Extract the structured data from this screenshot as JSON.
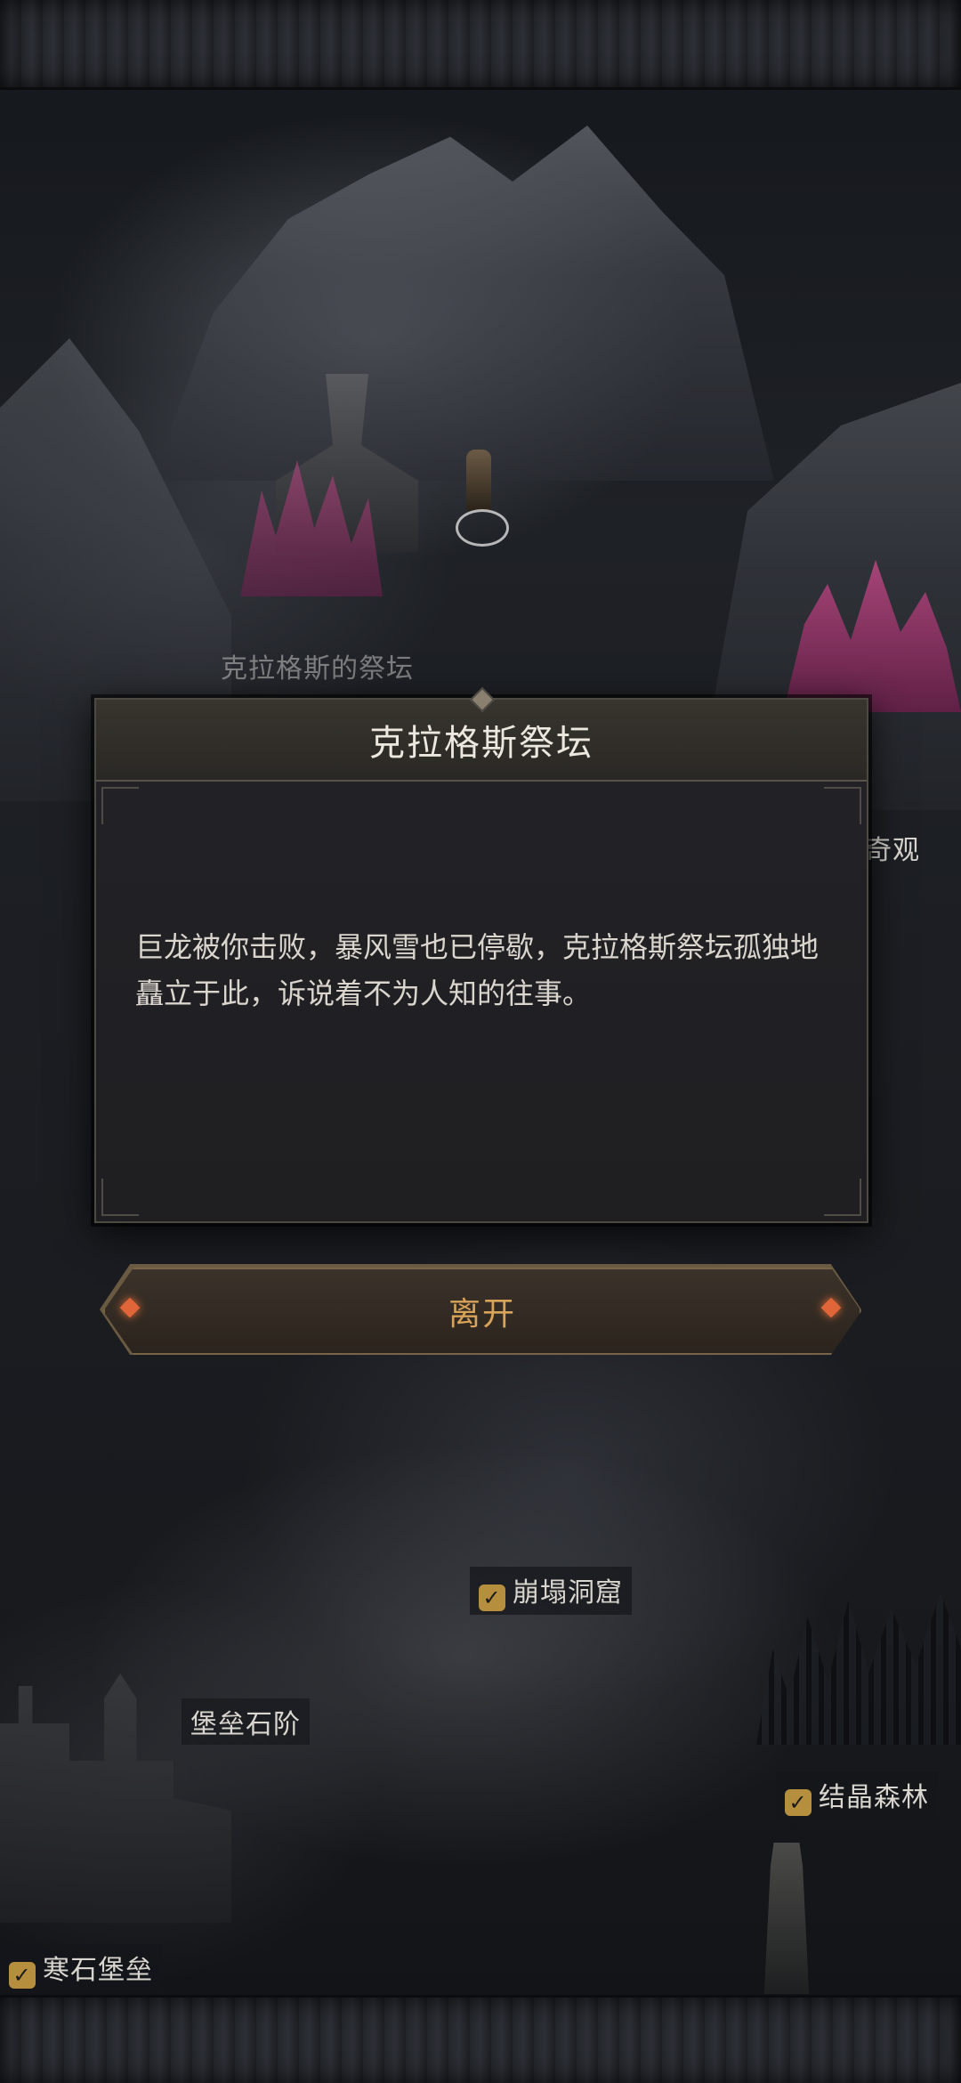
{
  "map": {
    "labels": {
      "altar_of_kragus": "克拉格斯的祭坛",
      "wonder_partial": "奇观",
      "collapsed_cave": "崩塌洞窟",
      "fortress_stairs": "堡垒石阶",
      "crystal_forest": "结晶森林",
      "coldstone_fortress": "寒石堡垒"
    }
  },
  "dialog": {
    "title": "克拉格斯祭坛",
    "body": "巨龙被你击败，暴风雪也已停歇，克拉格斯祭坛孤独地矗立于此，诉说着不为人知的往事。"
  },
  "actions": {
    "leave_label": "离开"
  },
  "colors": {
    "accent_gold": "#d9a35a",
    "check_gold": "#b58f3e",
    "gem_orange": "#e0663a",
    "crystal_pink": "#c04a86"
  }
}
